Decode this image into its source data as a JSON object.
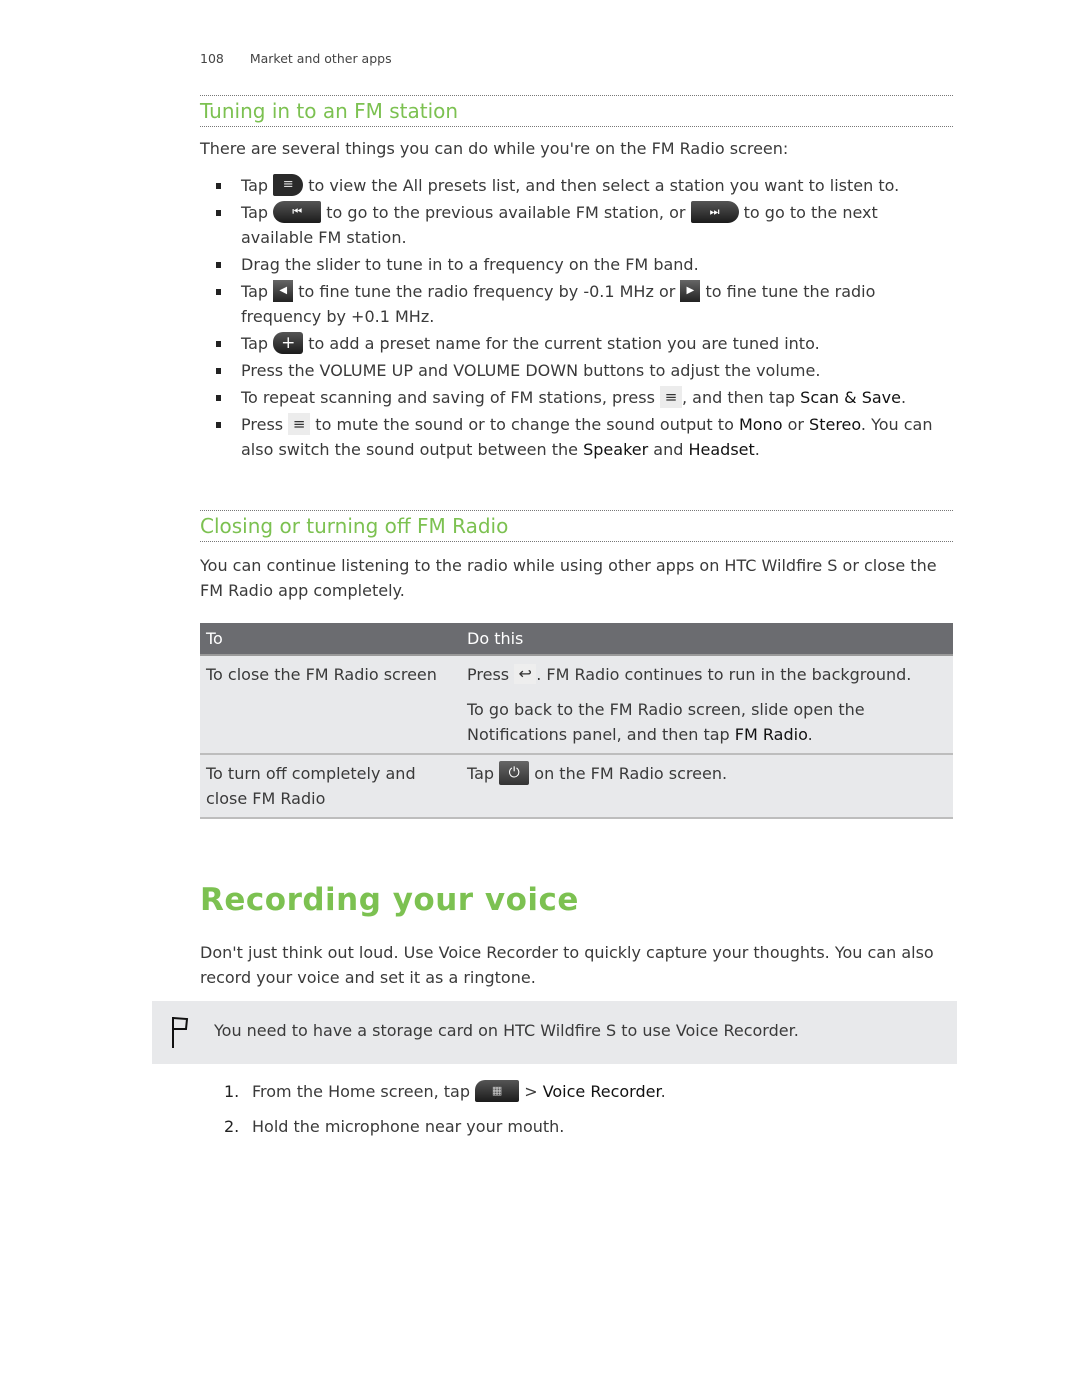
{
  "header": {
    "page_number": "108",
    "chapter": "Market and other apps"
  },
  "tuning": {
    "title": "Tuning in to an FM station",
    "intro": "There are several things you can do while you're on the FM Radio screen:",
    "bullets": [
      {
        "pre": "Tap",
        "icon": "presets-list-icon",
        "post": "to view the All presets list, and then select a station you want to listen to."
      },
      {
        "pre": "Tap",
        "icon": "previous-station-icon",
        "mid": "to go to the previous available FM station, or",
        "icon2": "next-station-icon",
        "post": "to go to the next available FM station."
      },
      {
        "text": "Drag the slider to tune in to a frequency on the FM band."
      },
      {
        "pre": "Tap",
        "icon": "fine-tune-down-icon",
        "mid": "to fine tune the radio frequency by -0.1 MHz or",
        "icon2": "fine-tune-up-icon",
        "post": "to fine tune the radio frequency by +0.1 MHz."
      },
      {
        "pre": "Tap",
        "icon": "add-preset-icon",
        "post": "to add a preset name for the current station you are tuned into."
      },
      {
        "text": "Press the VOLUME UP and VOLUME DOWN buttons to adjust the volume."
      },
      {
        "pre": "To repeat scanning and saving of FM stations, press",
        "icon": "menu-icon",
        "mid": ", and then tap",
        "em": "Scan & Save",
        "post": "."
      },
      {
        "pre": "Press",
        "icon": "menu-icon",
        "mid": "to mute the sound or to change the sound output to",
        "em1": "Mono",
        "or": "or",
        "em2": "Stereo",
        "line2_pre": ". You can also switch the sound output between the",
        "em3": "Speaker",
        "and": "and",
        "em4": "Headset",
        "end": "."
      }
    ]
  },
  "closing": {
    "title": "Closing or turning off FM Radio",
    "intro": "You can continue listening to the radio while using other apps on HTC Wildfire S or close the FM Radio app completely.",
    "table": {
      "headers": [
        "To",
        "Do this"
      ],
      "rows": [
        {
          "to": "To close the FM Radio screen",
          "do1_pre": "Press",
          "do1_icon": "back-icon",
          "do1_post": ". FM Radio continues to run in the background.",
          "do2_pre": "To go back to the FM Radio screen, slide open the Notifications panel, and then tap",
          "do2_em": "FM Radio",
          "do2_post": "."
        },
        {
          "to": "To turn off completely and close FM Radio",
          "do1_pre": "Tap",
          "do1_icon": "power-icon",
          "do1_post": "on the FM Radio screen."
        }
      ]
    }
  },
  "recording": {
    "title": "Recording your voice",
    "intro": "Don't just think out loud. Use Voice Recorder to quickly capture your thoughts. You can also record your voice and set it as a ringtone.",
    "note": "You need to have a storage card on HTC Wildfire S to use Voice Recorder.",
    "steps": [
      {
        "num": "1.",
        "pre": "From the Home screen, tap",
        "icon": "all-apps-icon",
        "mid": ">",
        "em": "Voice Recorder",
        "post": "."
      },
      {
        "num": "2.",
        "text": "Hold the microphone near your mouth."
      }
    ]
  },
  "icons": {
    "presets": "≡",
    "prev": "⏮",
    "next": "⏭",
    "fine_down": "◀",
    "fine_up": "▶",
    "add": "+",
    "menu": "≡",
    "back": "↩",
    "power": "⏻",
    "apps": "▦"
  },
  "colors": {
    "heading_green": "#7cc151",
    "table_header": "#6b6c70",
    "table_body": "#e8e9eb"
  }
}
